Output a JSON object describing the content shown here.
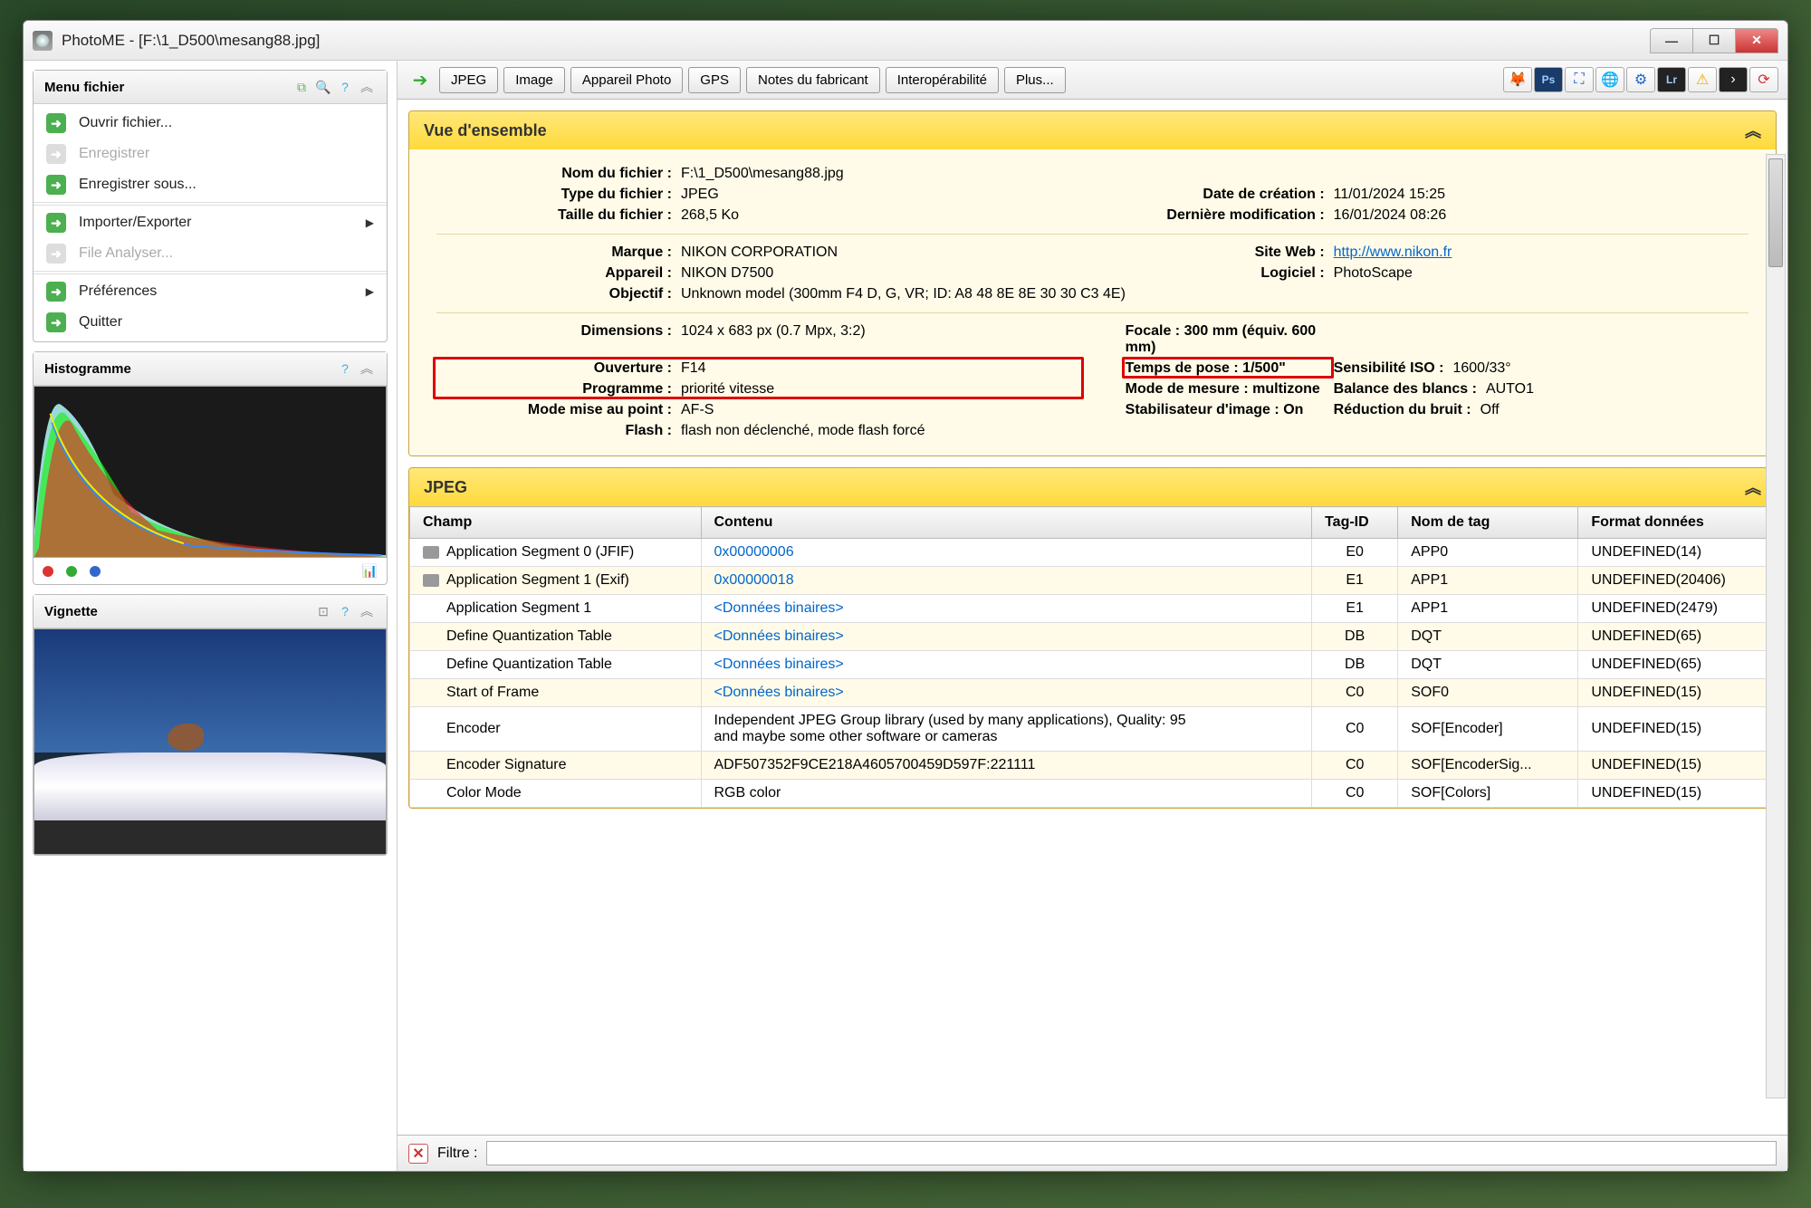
{
  "window": {
    "title": "PhotoME - [F:\\1_D500\\mesang88.jpg]"
  },
  "sidebar": {
    "menu_title": "Menu fichier",
    "items": [
      {
        "label": "Ouvrir fichier...",
        "enabled": true
      },
      {
        "label": "Enregistrer",
        "enabled": false
      },
      {
        "label": "Enregistrer sous...",
        "enabled": true
      },
      {
        "label": "Importer/Exporter",
        "enabled": true,
        "submenu": true
      },
      {
        "label": "File Analyser...",
        "enabled": false
      },
      {
        "label": "Préférences",
        "enabled": true,
        "submenu": true
      },
      {
        "label": "Quitter",
        "enabled": true
      }
    ],
    "histogram_title": "Histogramme",
    "thumbnail_title": "Vignette"
  },
  "toolbar": {
    "tabs": [
      "JPEG",
      "Image",
      "Appareil Photo",
      "GPS",
      "Notes du fabricant",
      "Interopérabilité",
      "Plus..."
    ]
  },
  "overview": {
    "title": "Vue d'ensemble",
    "labels": {
      "filename": "Nom du fichier :",
      "filetype": "Type du fichier :",
      "filesize": "Taille du fichier :",
      "created": "Date de création :",
      "modified": "Dernière modification :",
      "make": "Marque :",
      "camera": "Appareil :",
      "lens": "Objectif :",
      "website": "Site Web :",
      "software": "Logiciel :",
      "dimensions": "Dimensions :",
      "focal": "Focale :",
      "aperture": "Ouverture :",
      "exposure": "Temps de pose :",
      "iso": "Sensibilité ISO :",
      "program": "Programme :",
      "metering": "Mode de mesure :",
      "wb": "Balance des blancs :",
      "afmode": "Mode mise au point :",
      "stab": "Stabilisateur d'image :",
      "nr": "Réduction du bruit :",
      "flash": "Flash :"
    },
    "values": {
      "filename": "F:\\1_D500\\mesang88.jpg",
      "filetype": "JPEG",
      "filesize": "268,5 Ko",
      "created": "11/01/2024 15:25",
      "modified": "16/01/2024 08:26",
      "make": "NIKON CORPORATION",
      "camera": "NIKON D7500",
      "lens": "Unknown model (300mm F4 D, G, VR; ID: A8 48 8E 8E 30 30 C3 4E)",
      "website": "http://www.nikon.fr",
      "software": "PhotoScape",
      "dimensions": "1024 x 683 px (0.7 Mpx, 3:2)",
      "focal": "300 mm (équiv. 600 mm)",
      "aperture": "F14",
      "exposure": "1/500\"",
      "iso": "1600/33°",
      "program": "priorité vitesse",
      "metering": "multizone",
      "wb": "AUTO1",
      "afmode": "AF-S",
      "stab": "On",
      "nr": "Off",
      "flash": "flash non déclenché, mode flash forcé"
    }
  },
  "jpeg_section": {
    "title": "JPEG",
    "headers": [
      "Champ",
      "Contenu",
      "Tag-ID",
      "Nom de tag",
      "Format données"
    ],
    "rows": [
      {
        "icon": true,
        "champ": "Application Segment 0 (JFIF)",
        "contenu": "0x00000006",
        "contenu_link": true,
        "tagid": "E0",
        "nom": "APP0",
        "fmt": "UNDEFINED(14)"
      },
      {
        "icon": true,
        "champ": "Application Segment 1 (Exif)",
        "contenu": "0x00000018",
        "contenu_link": true,
        "tagid": "E1",
        "nom": "APP1",
        "fmt": "UNDEFINED(20406)"
      },
      {
        "champ": "Application Segment 1",
        "contenu": "<Données binaires>",
        "contenu_link": true,
        "tagid": "E1",
        "nom": "APP1",
        "fmt": "UNDEFINED(2479)"
      },
      {
        "champ": "Define Quantization Table",
        "contenu": "<Données binaires>",
        "contenu_link": true,
        "tagid": "DB",
        "nom": "DQT",
        "fmt": "UNDEFINED(65)"
      },
      {
        "champ": "Define Quantization Table",
        "contenu": "<Données binaires>",
        "contenu_link": true,
        "tagid": "DB",
        "nom": "DQT",
        "fmt": "UNDEFINED(65)"
      },
      {
        "champ": "Start of Frame",
        "contenu": "<Données binaires>",
        "contenu_link": true,
        "tagid": "C0",
        "nom": "SOF0",
        "fmt": "UNDEFINED(15)"
      },
      {
        "champ": "Encoder",
        "contenu": "Independent JPEG Group library (used by many applications), Quality: 95\nand maybe some other software or cameras",
        "tagid": "C0",
        "nom": "SOF[Encoder]",
        "fmt": "UNDEFINED(15)"
      },
      {
        "champ": "Encoder Signature",
        "contenu": "ADF507352F9CE218A4605700459D597F:221111",
        "tagid": "C0",
        "nom": "SOF[EncoderSig...",
        "fmt": "UNDEFINED(15)"
      },
      {
        "champ": "Color Mode",
        "contenu": "RGB color",
        "tagid": "C0",
        "nom": "SOF[Colors]",
        "fmt": "UNDEFINED(15)"
      }
    ]
  },
  "filter": {
    "label": "Filtre :"
  }
}
